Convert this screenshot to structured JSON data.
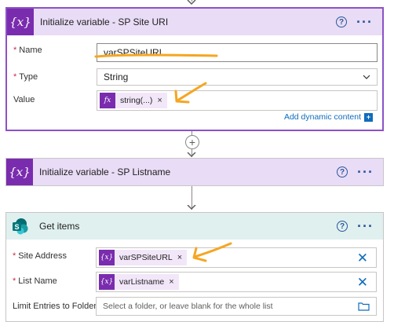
{
  "actions": {
    "init_uri": {
      "title": "Initialize variable - SP Site URI",
      "name_label": "Name",
      "name_value": "varSPSiteURL",
      "type_label": "Type",
      "type_value": "String",
      "value_label": "Value",
      "value_token": "string(...)",
      "add_dynamic": "Add dynamic content"
    },
    "init_listname": {
      "title": "Initialize variable - SP Listname"
    },
    "get_items": {
      "title": "Get items",
      "site_label": "Site Address",
      "site_token": "varSPSiteURL",
      "list_label": "List Name",
      "list_token": "varListname",
      "folder_label": "Limit Entries to Folder",
      "folder_placeholder": "Select a folder, or leave blank for the whole list"
    }
  },
  "icons": {
    "variable": "{x}",
    "expression": "fx",
    "sharepoint": "S",
    "help": "?",
    "more": "···",
    "remove": "×",
    "clear": "✕",
    "insert": "+",
    "add_dynamic": "+"
  },
  "colors": {
    "variable_accent": "#7a2cae",
    "selected_border": "#8b52c6",
    "link_blue": "#0f6cbd",
    "annotation": "#f5a623",
    "sharepoint": "#038387"
  }
}
